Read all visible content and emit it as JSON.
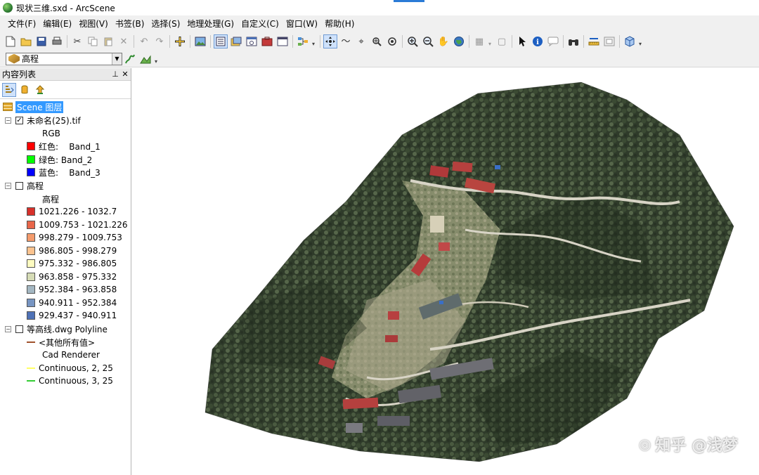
{
  "window": {
    "title": "现状三维.sxd - ArcScene"
  },
  "menubar": {
    "items": [
      "文件(F)",
      "编辑(E)",
      "视图(V)",
      "书签(B)",
      "选择(S)",
      "地理处理(G)",
      "自定义(C)",
      "窗口(W)",
      "帮助(H)"
    ]
  },
  "toolbar2": {
    "layer_select_value": "高程"
  },
  "toc": {
    "title": "内容列表",
    "scene_layer": "Scene 图层",
    "raster_layer": {
      "name": "未命名(25).tif",
      "checked": true,
      "renderer": "RGB",
      "bands": [
        {
          "label": "红色:    Band_1",
          "color": "#ff0000"
        },
        {
          "label": "绿色: Band_2",
          "color": "#00ff00"
        },
        {
          "label": "蓝色:    Band_3",
          "color": "#0000ff"
        }
      ]
    },
    "elevation_layer": {
      "name": "高程",
      "checked": false,
      "field": "高程",
      "classes": [
        {
          "label": "1021.226 - 1032.7",
          "color": "#d7302a"
        },
        {
          "label": "1009.753 - 1021.226",
          "color": "#e8664a"
        },
        {
          "label": "998.279 - 1009.753",
          "color": "#f49b6c"
        },
        {
          "label": "986.805 - 998.279",
          "color": "#fcc38f"
        },
        {
          "label": "975.332 - 986.805",
          "color": "#fefcc0"
        },
        {
          "label": "963.858 - 975.332",
          "color": "#d6dcb6"
        },
        {
          "label": "952.384 - 963.858",
          "color": "#a4b7c2"
        },
        {
          "label": "940.911 - 952.384",
          "color": "#7795c2"
        },
        {
          "label": "929.437 - 940.911",
          "color": "#4f72b6"
        }
      ]
    },
    "contour_layer": {
      "name": "等高线.dwg Polyline",
      "checked": false,
      "entries": [
        {
          "label": "<其他所有值>",
          "color": "#a0522d"
        },
        {
          "label": "Cad Renderer",
          "color": ""
        },
        {
          "label": "Continuous, 2, 25",
          "color": "#ffff66"
        },
        {
          "label": "Continuous, 3, 25",
          "color": "#33cc33"
        }
      ]
    }
  },
  "watermark": {
    "text": "知乎 @浅梦"
  }
}
